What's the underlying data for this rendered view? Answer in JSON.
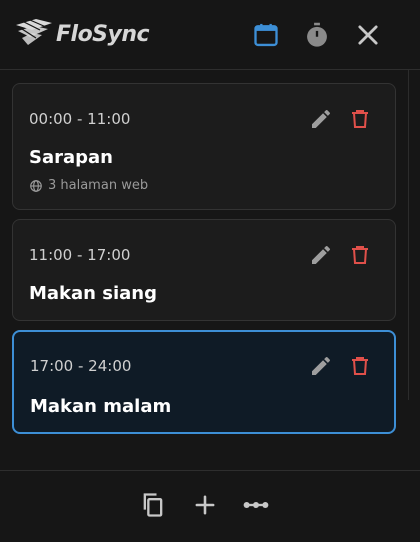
{
  "app": {
    "name": "FloSync"
  },
  "header": {
    "icons": [
      "calendar-icon",
      "timer-icon",
      "close-icon"
    ],
    "active_color": "#3d8fd6"
  },
  "schedules": [
    {
      "time": "00:00 - 11:00",
      "title": "Sarapan",
      "meta": "3 halaman web",
      "active": false
    },
    {
      "time": "11:00 - 17:00",
      "title": "Makan siang",
      "active": false
    },
    {
      "time": "17:00 - 24:00",
      "title": "Makan malam",
      "active": true
    }
  ],
  "colors": {
    "delete": "#e0504a",
    "edit": "#9e9e9e",
    "accent": "#3d8fd6"
  },
  "footer": {
    "icons": [
      "copy-icon",
      "add-icon",
      "more-icon"
    ]
  }
}
